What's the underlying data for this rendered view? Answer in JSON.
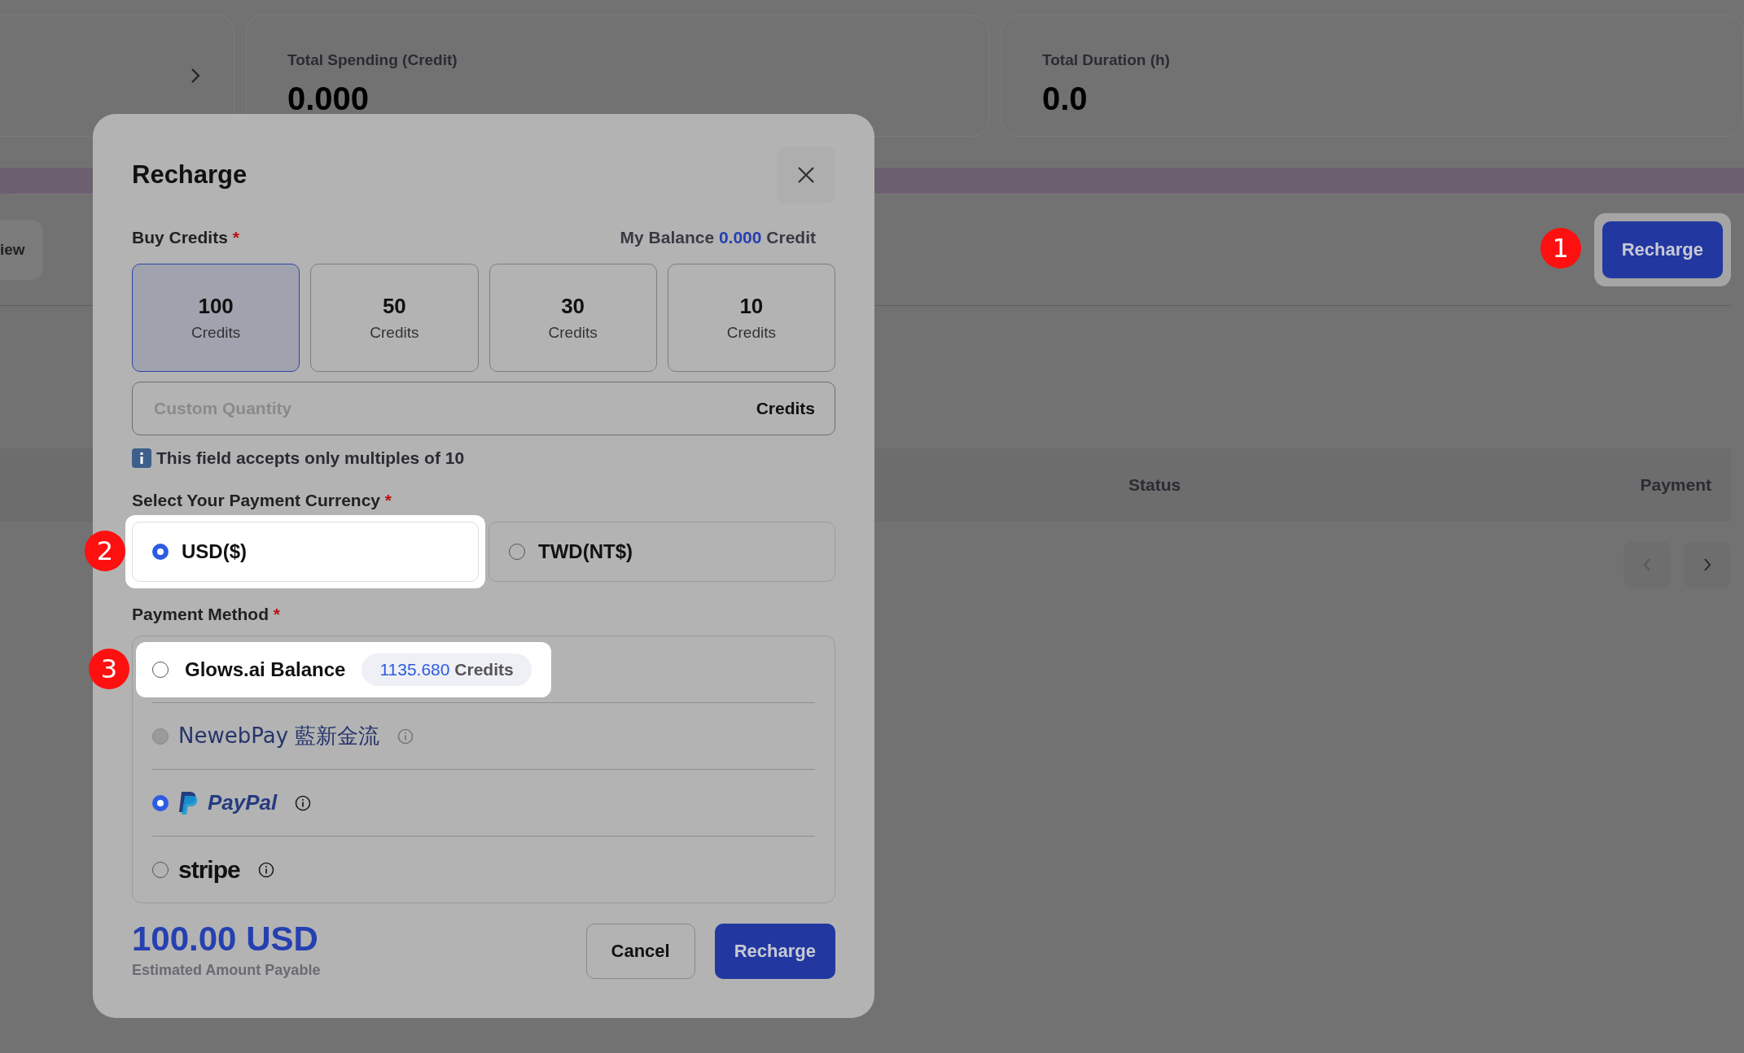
{
  "stats": [
    {
      "label": "Total Spending (Credit)",
      "value": "0.000"
    },
    {
      "label": "Total Duration (h)",
      "value": "0.0"
    }
  ],
  "toolbar": {
    "tab_partial": "iew",
    "recharge_button": "Recharge",
    "badge": "1"
  },
  "table": {
    "columns": [
      "Status",
      "Payment"
    ]
  },
  "modal": {
    "title": "Recharge",
    "required_mark": "*",
    "buy_label": "Buy Credits",
    "balance_label": "My Balance",
    "balance_value": "0.000",
    "balance_unit": "Credit",
    "packages": [
      {
        "amount": "100",
        "unit": "Credits",
        "selected": true
      },
      {
        "amount": "50",
        "unit": "Credits",
        "selected": false
      },
      {
        "amount": "30",
        "unit": "Credits",
        "selected": false
      },
      {
        "amount": "10",
        "unit": "Credits",
        "selected": false
      }
    ],
    "custom": {
      "placeholder": "Custom Quantity",
      "unit": "Credits"
    },
    "hint": "This field accepts only multiples of 10",
    "currency_label": "Select Your Payment Currency",
    "currencies": [
      {
        "label": "USD($)",
        "selected": true,
        "badge": "2"
      },
      {
        "label": "TWD(NT$)",
        "selected": false
      }
    ],
    "method_label": "Payment Method",
    "methods": [
      {
        "kind": "balance",
        "label": "Glows.ai Balance",
        "amount": "1135.680",
        "unit": "Credits",
        "selected": false,
        "disabled": false,
        "info": false,
        "badge": "3"
      },
      {
        "kind": "newebpay",
        "label": "NewebPay",
        "label_cjk": "藍新金流",
        "selected": false,
        "disabled": true,
        "info": true
      },
      {
        "kind": "paypal",
        "label": "PayPal",
        "selected": true,
        "disabled": false,
        "info": true
      },
      {
        "kind": "stripe",
        "label": "stripe",
        "selected": false,
        "disabled": false,
        "info": true
      }
    ],
    "total": "100.00 USD",
    "total_caption": "Estimated Amount Payable",
    "cancel_button": "Cancel",
    "submit_button": "Recharge"
  }
}
